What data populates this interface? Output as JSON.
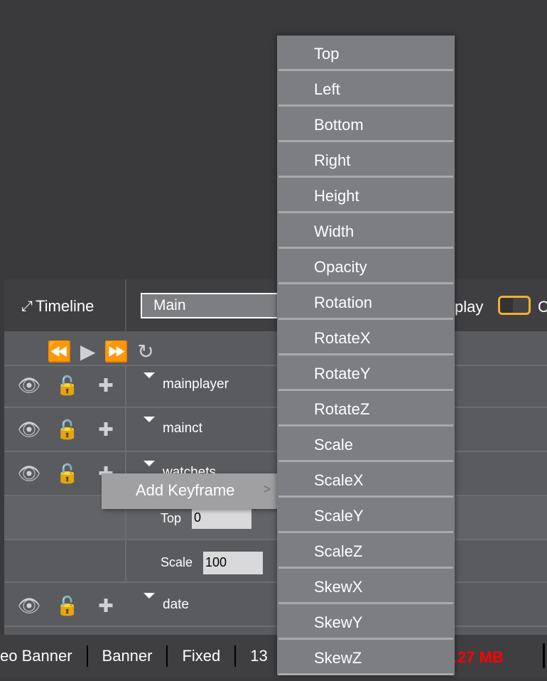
{
  "header": {
    "title": "Timeline",
    "scene_select": "Main",
    "display_label": "play",
    "c_label": "C",
    "toggle_on": false,
    "toggle_color": "#f0b030"
  },
  "controls": [
    "rewind-icon",
    "play-icon",
    "fast-forward-icon",
    "reload-icon"
  ],
  "layers": [
    {
      "name": "mainplayer"
    },
    {
      "name": "mainct"
    },
    {
      "name": "watchets"
    },
    {
      "name": "date"
    }
  ],
  "properties": [
    {
      "label": "Top",
      "value": "0"
    },
    {
      "label": "Scale",
      "value": "100"
    }
  ],
  "context_menu": {
    "label": "Add Keyframe",
    "arrow": ">"
  },
  "submenu": [
    "Top",
    "Left",
    "Bottom",
    "Right",
    "Height",
    "Width",
    "Opacity",
    "Rotation",
    "RotateX",
    "RotateY",
    "RotateZ",
    "Scale",
    "ScaleX",
    "ScaleY",
    "ScaleZ",
    "SkewX",
    "SkewY",
    "SkewZ"
  ],
  "status": {
    "items": [
      "eo Banner",
      "Banner",
      "Fixed",
      "13"
    ],
    "size": "e: 6.27 MB",
    "size_color": "#ff0000"
  }
}
